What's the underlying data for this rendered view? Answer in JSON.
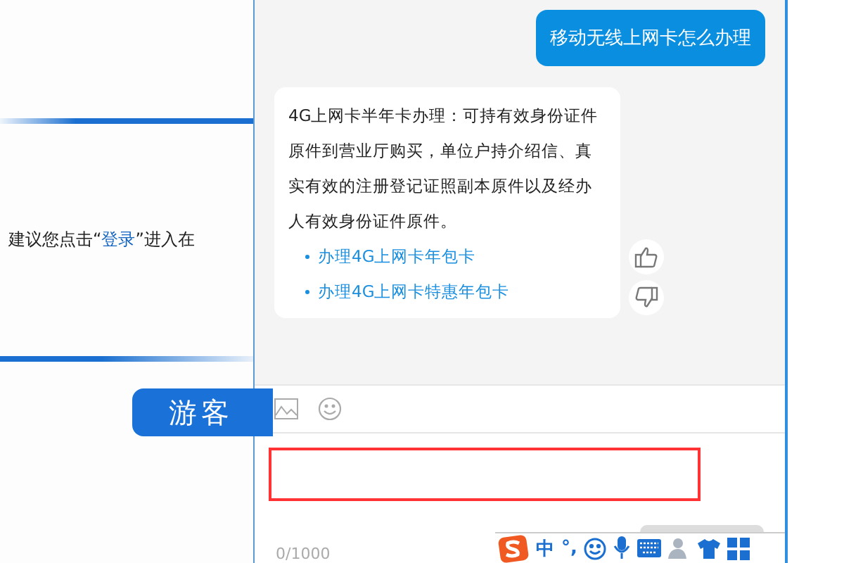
{
  "left_page": {
    "notice_prefix": "建议您点击“",
    "login_link": "登录",
    "notice_suffix": "”进入在",
    "guest_button": "游客"
  },
  "chat": {
    "messages": [
      {
        "kind": "user",
        "text": "移动无线上网卡怎么办理"
      },
      {
        "kind": "bot",
        "text": "4G上网卡半年卡办理：可持有效身份证件原件到营业厅购买，单位户持介绍信、真实有效的注册登记证照副本原件以及经办人有效身份证件原件。",
        "links": [
          "办理4G上网卡年包卡",
          "办理4G上网卡特惠年包卡"
        ]
      }
    ],
    "counter": "0/1000"
  },
  "ime_bar": {
    "lang": "中",
    "punct": "°,"
  }
}
